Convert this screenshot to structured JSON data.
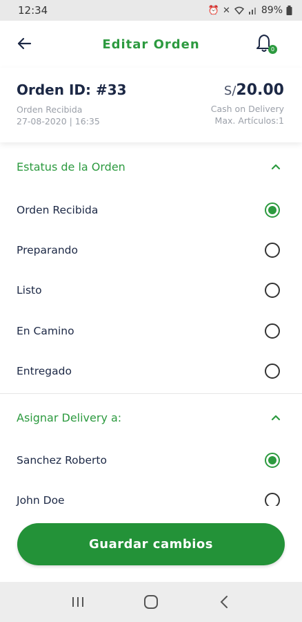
{
  "status_bar": {
    "time": "12:34",
    "battery": "89%"
  },
  "header": {
    "title": "Editar Orden",
    "notification_count": "0"
  },
  "order": {
    "id_label": "Orden ID: #33",
    "status_text": "Orden Recibida",
    "datetime": "27-08-2020 | 16:35",
    "currency": "S/",
    "amount": "20.00",
    "payment_method": "Cash on Delivery",
    "max_items": "Max. Artículos:1"
  },
  "status_section": {
    "title": "Estatus de la Orden",
    "options": [
      {
        "label": "Orden Recibida",
        "selected": true
      },
      {
        "label": "Preparando",
        "selected": false
      },
      {
        "label": "Listo",
        "selected": false
      },
      {
        "label": "En Camino",
        "selected": false
      },
      {
        "label": "Entregado",
        "selected": false
      }
    ]
  },
  "delivery_section": {
    "title": "Asignar Delivery a:",
    "options": [
      {
        "label": "Sanchez Roberto",
        "selected": true
      },
      {
        "label": "John Doe",
        "selected": false
      }
    ]
  },
  "save_button": {
    "label": "Guardar cambios"
  },
  "colors": {
    "accent": "#2c9a3f",
    "button": "#239238",
    "text_dark": "#1c2845",
    "text_muted": "#9a9fa8"
  }
}
